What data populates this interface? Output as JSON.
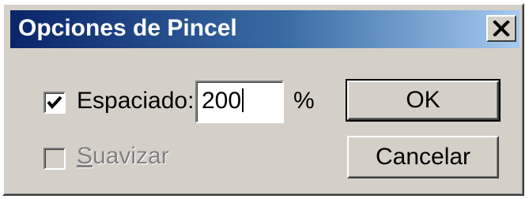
{
  "window": {
    "title": "Opciones de Pincel",
    "close_icon": "close-icon"
  },
  "options": {
    "spacing": {
      "label": "Espaciado:",
      "checked": true,
      "value": "200",
      "unit": "%"
    },
    "smooth": {
      "label": "Suavizar",
      "checked": false,
      "enabled": false
    }
  },
  "buttons": {
    "ok_label": "OK",
    "cancel_label": "Cancelar"
  }
}
